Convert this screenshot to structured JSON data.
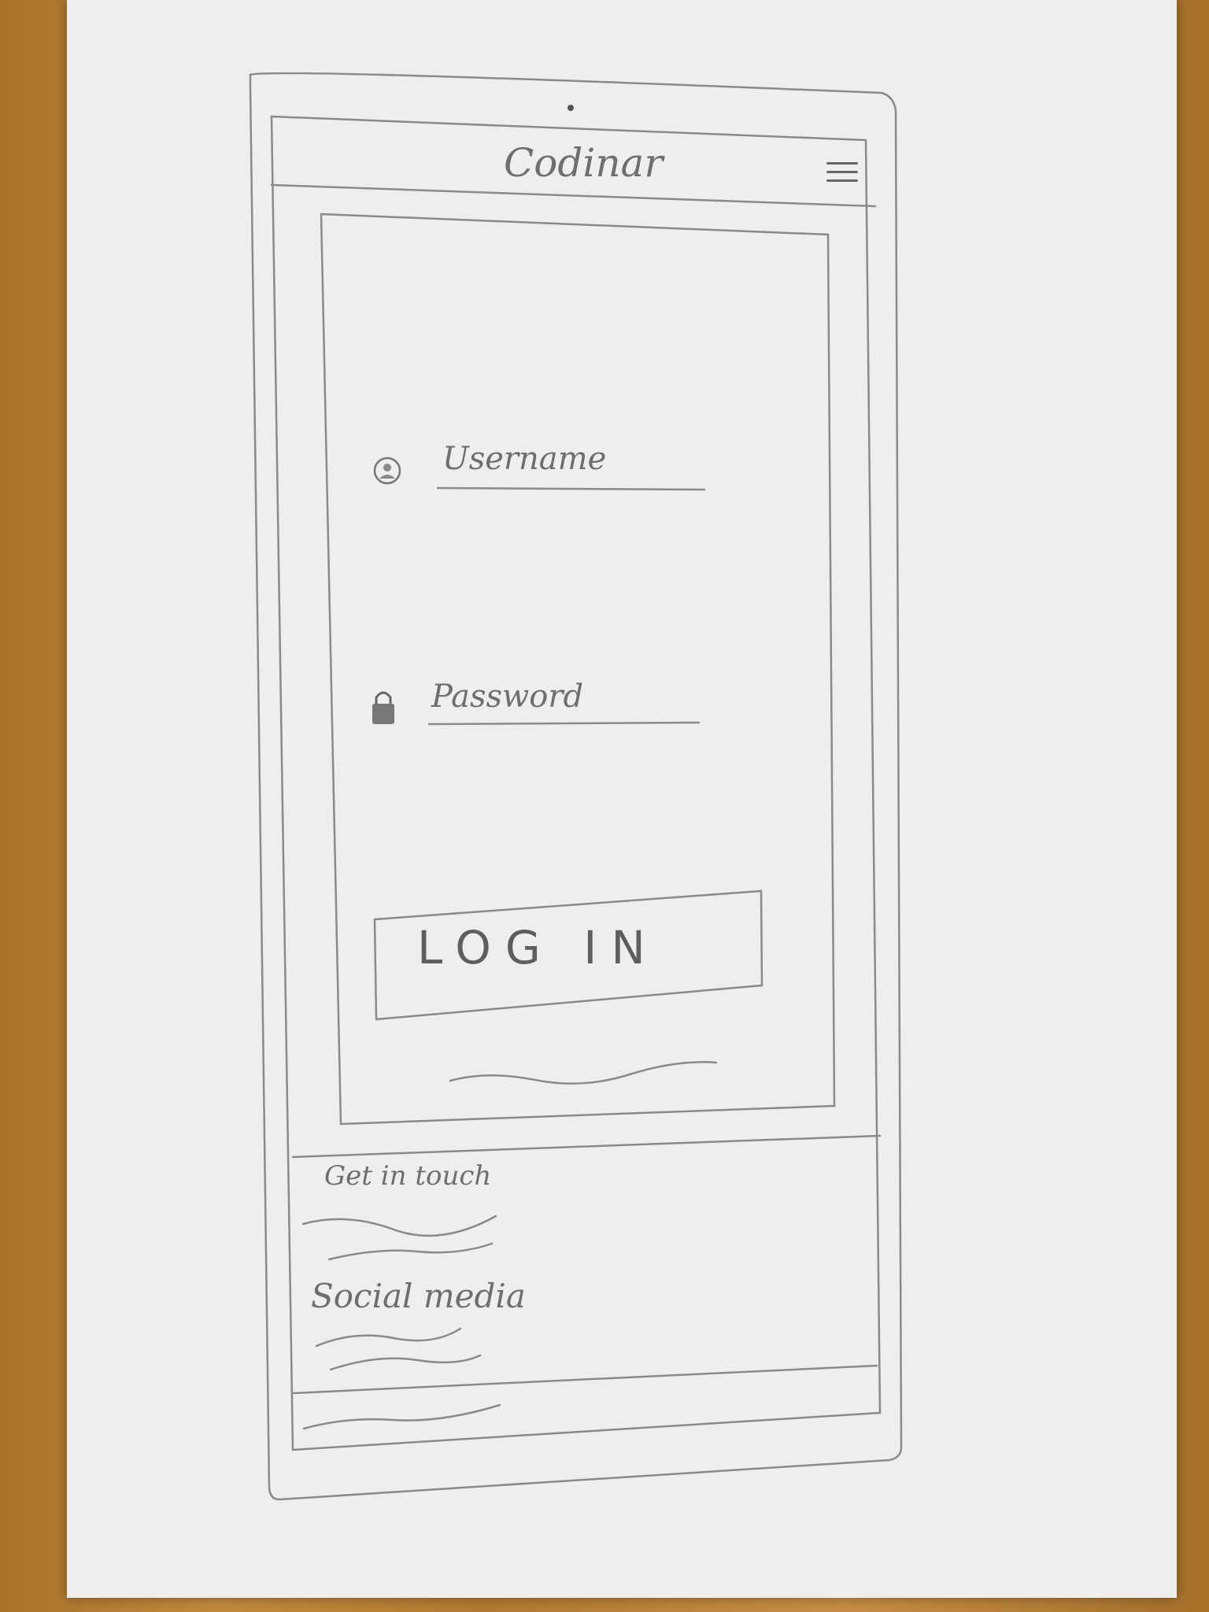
{
  "header": {
    "title": "Codinar",
    "menu_icon": "hamburger-menu-icon"
  },
  "login_form": {
    "username_placeholder": "Username",
    "username_icon": "user-icon",
    "password_placeholder": "Password",
    "password_icon": "lock-icon",
    "login_button_label": "LOG IN"
  },
  "footer": {
    "contact_heading": "Get in touch",
    "social_heading": "Social media"
  }
}
